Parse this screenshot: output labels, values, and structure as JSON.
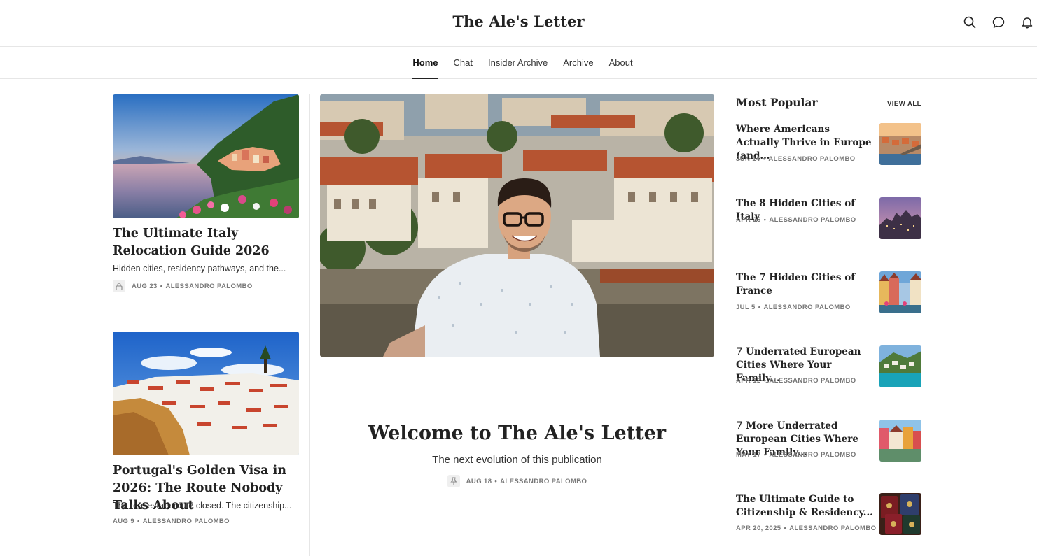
{
  "header": {
    "site_title": "The Ale's Letter",
    "icons": [
      "search-icon",
      "chat-bubble-icon",
      "bell-icon"
    ]
  },
  "nav": {
    "items": [
      "Home",
      "Chat",
      "Insider Archive",
      "Archive",
      "About"
    ],
    "active": "Home"
  },
  "left_posts": [
    {
      "title": "The Ultimate Italy Relocation Guide 2026",
      "subtitle": "Hidden cities, residency pathways, and the...",
      "date": "AUG 23",
      "author": "ALESSANDRO PALOMBO",
      "locked": true
    },
    {
      "title": "Portugal's Golden Visa in 2026: The Route Nobody Talks About",
      "subtitle": "The real estate route closed. The citizenship...",
      "date": "AUG 9",
      "author": "ALESSANDRO PALOMBO",
      "locked": false
    }
  ],
  "featured": {
    "title": "Welcome to The Ale's Letter",
    "subtitle": "The next evolution of this publication",
    "date": "AUG 18",
    "author": "ALESSANDRO PALOMBO",
    "pinned": true
  },
  "most_popular": {
    "heading": "Most Popular",
    "view_all": "VIEW ALL",
    "items": [
      {
        "title": "Where Americans Actually Thrive in Europe (and...",
        "date": "JUN 14",
        "author": "ALESSANDRO PALOMBO"
      },
      {
        "title": "The 8 Hidden Cities of Italy",
        "date": "APR 26",
        "author": "ALESSANDRO PALOMBO"
      },
      {
        "title": "The 7 Hidden Cities of France",
        "date": "JUL 5",
        "author": "ALESSANDRO PALOMBO"
      },
      {
        "title": "7 Underrated European Cities Where Your Family...",
        "date": "APR 12",
        "author": "ALESSANDRO PALOMBO"
      },
      {
        "title": "7 More Underrated European Cities Where Your Family...",
        "date": "MAY 17",
        "author": "ALESSANDRO PALOMBO"
      },
      {
        "title": "The Ultimate Guide to Citizenship & Residency...",
        "date": "APR 20, 2025",
        "author": "ALESSANDRO PALOMBO"
      }
    ]
  },
  "separator": "•"
}
